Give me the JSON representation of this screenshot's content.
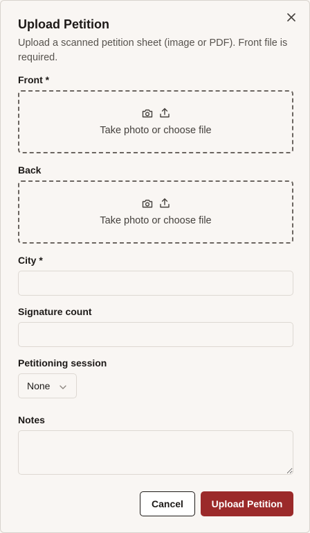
{
  "dialog": {
    "title": "Upload Petition",
    "description": "Upload a scanned petition sheet (image or PDF). Front file is required.",
    "close_icon": "close-icon"
  },
  "front": {
    "label": "Front *",
    "dropzone_text": "Take photo or choose file",
    "icons": [
      "camera-icon",
      "upload-icon"
    ]
  },
  "back": {
    "label": "Back",
    "dropzone_text": "Take photo or choose file",
    "icons": [
      "camera-icon",
      "upload-icon"
    ]
  },
  "city": {
    "label": "City *",
    "value": "",
    "placeholder": ""
  },
  "signature_count": {
    "label": "Signature count",
    "value": "",
    "placeholder": ""
  },
  "session": {
    "label": "Petitioning session",
    "selected": "None"
  },
  "notes": {
    "label": "Notes",
    "value": ""
  },
  "actions": {
    "cancel_label": "Cancel",
    "submit_label": "Upload Petition"
  },
  "colors": {
    "primary": "#9b2a2a",
    "background": "#f9f6f3",
    "text": "#1c1917",
    "muted": "#57534e"
  }
}
